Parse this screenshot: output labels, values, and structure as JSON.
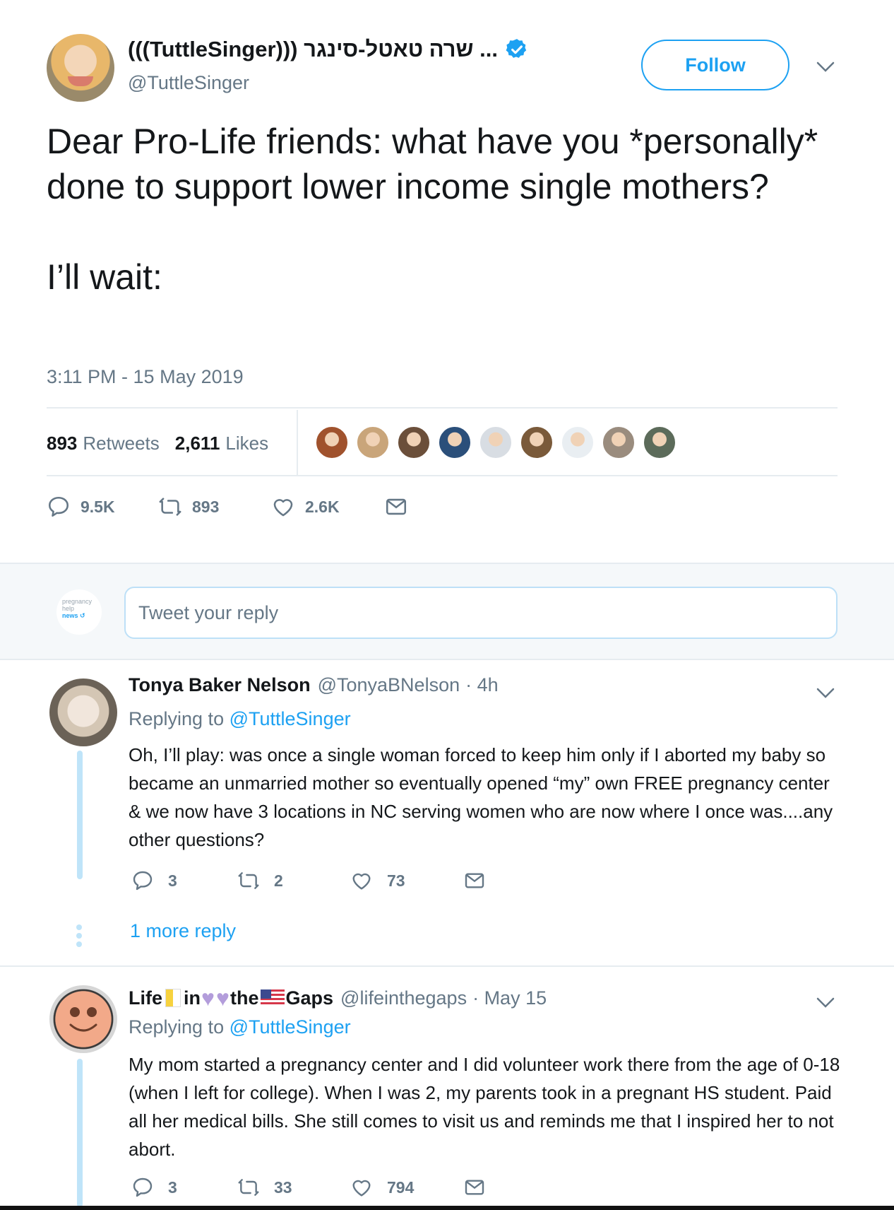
{
  "tweet": {
    "display_name": "(((TuttleSinger))) שרה טאטל-סינגר ...",
    "handle": "@TuttleSinger",
    "follow_label": "Follow",
    "text": "Dear Pro-Life friends: what have you *personally* done to support lower income single mothers?\n\nI’ll wait:",
    "timestamp": "3:11 PM - 15 May 2019",
    "retweets_count": "893",
    "retweets_label": "Retweets",
    "likes_count": "2,611",
    "likes_label": "Likes",
    "liker_colors": [
      "#a0522d",
      "#c9a57a",
      "#6b4f3a",
      "#2b4f7a",
      "#d8dde3",
      "#7a5a3a",
      "#e9eef2",
      "#9a8c7e",
      "#5c6b5a"
    ],
    "actions": {
      "replies": "9.5K",
      "retweets": "893",
      "likes": "2.6K"
    }
  },
  "reply_box": {
    "placeholder": "Tweet your reply",
    "logo_line1": "pregnancy",
    "logo_line2": "help",
    "logo_line3": "news"
  },
  "replies": [
    {
      "name": "Tonya Baker Nelson",
      "handle": "@TonyaBNelson",
      "time": "· 4h",
      "replying_prefix": "Replying to",
      "replying_to": "@TuttleSinger",
      "text": "Oh, I’ll play: was once a single woman forced to keep him only if I aborted my baby so became an unmarried mother so eventually opened “my” own FREE pregnancy center & we now have 3 locations in NC serving women who are now where I once was....any other questions?",
      "replies": "3",
      "retweets": "2",
      "likes": "73",
      "more": "1 more reply"
    },
    {
      "name_part1": "Life",
      "name_part2": "in",
      "name_part3": "the",
      "name_part4": "Gaps",
      "handle": "@lifeinthegaps",
      "time": "· May 15",
      "replying_prefix": "Replying to",
      "replying_to": "@TuttleSinger",
      "text": "My mom started a pregnancy center and I did volunteer work there from the age of 0-18 (when I left for college). When I was 2, my parents took in a pregnant HS student. Paid all her medical bills. She still comes to visit us and reminds me that I inspired her to not abort.",
      "replies": "3",
      "retweets": "33",
      "likes": "794"
    }
  ]
}
